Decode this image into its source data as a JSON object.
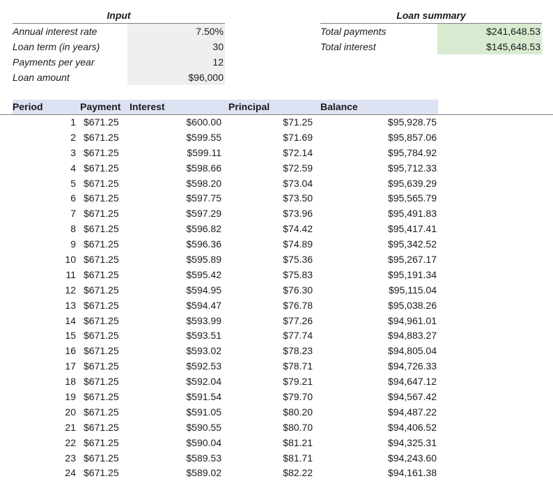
{
  "input": {
    "title": "Input",
    "rows": [
      {
        "label": "Annual interest rate",
        "value": "7.50%"
      },
      {
        "label": "Loan term (in years)",
        "value": "30"
      },
      {
        "label": "Payments per year",
        "value": "12"
      },
      {
        "label": "Loan amount",
        "value": "$96,000"
      }
    ]
  },
  "summary": {
    "title": "Loan summary",
    "rows": [
      {
        "label": "Total payments",
        "value": "$241,648.53"
      },
      {
        "label": "Total interest",
        "value": "$145,648.53"
      }
    ]
  },
  "table": {
    "headers": {
      "period": "Period",
      "payment": "Payment",
      "interest": "Interest",
      "principal": "Principal",
      "balance": "Balance"
    },
    "rows": [
      [
        "1",
        "$671.25",
        "$600.00",
        "$71.25",
        "$95,928.75"
      ],
      [
        "2",
        "$671.25",
        "$599.55",
        "$71.69",
        "$95,857.06"
      ],
      [
        "3",
        "$671.25",
        "$599.11",
        "$72.14",
        "$95,784.92"
      ],
      [
        "4",
        "$671.25",
        "$598.66",
        "$72.59",
        "$95,712.33"
      ],
      [
        "5",
        "$671.25",
        "$598.20",
        "$73.04",
        "$95,639.29"
      ],
      [
        "6",
        "$671.25",
        "$597.75",
        "$73.50",
        "$95,565.79"
      ],
      [
        "7",
        "$671.25",
        "$597.29",
        "$73.96",
        "$95,491.83"
      ],
      [
        "8",
        "$671.25",
        "$596.82",
        "$74.42",
        "$95,417.41"
      ],
      [
        "9",
        "$671.25",
        "$596.36",
        "$74.89",
        "$95,342.52"
      ],
      [
        "10",
        "$671.25",
        "$595.89",
        "$75.36",
        "$95,267.17"
      ],
      [
        "11",
        "$671.25",
        "$595.42",
        "$75.83",
        "$95,191.34"
      ],
      [
        "12",
        "$671.25",
        "$594.95",
        "$76.30",
        "$95,115.04"
      ],
      [
        "13",
        "$671.25",
        "$594.47",
        "$76.78",
        "$95,038.26"
      ],
      [
        "14",
        "$671.25",
        "$593.99",
        "$77.26",
        "$94,961.01"
      ],
      [
        "15",
        "$671.25",
        "$593.51",
        "$77.74",
        "$94,883.27"
      ],
      [
        "16",
        "$671.25",
        "$593.02",
        "$78.23",
        "$94,805.04"
      ],
      [
        "17",
        "$671.25",
        "$592.53",
        "$78.71",
        "$94,726.33"
      ],
      [
        "18",
        "$671.25",
        "$592.04",
        "$79.21",
        "$94,647.12"
      ],
      [
        "19",
        "$671.25",
        "$591.54",
        "$79.70",
        "$94,567.42"
      ],
      [
        "20",
        "$671.25",
        "$591.05",
        "$80.20",
        "$94,487.22"
      ],
      [
        "21",
        "$671.25",
        "$590.55",
        "$80.70",
        "$94,406.52"
      ],
      [
        "22",
        "$671.25",
        "$590.04",
        "$81.21",
        "$94,325.31"
      ],
      [
        "23",
        "$671.25",
        "$589.53",
        "$81.71",
        "$94,243.60"
      ],
      [
        "24",
        "$671.25",
        "$589.02",
        "$82.22",
        "$94,161.38"
      ]
    ]
  },
  "colors": {
    "input_fill": "#efefef",
    "summary_fill": "#d8ebd1",
    "header_fill": "#dde2f3"
  }
}
